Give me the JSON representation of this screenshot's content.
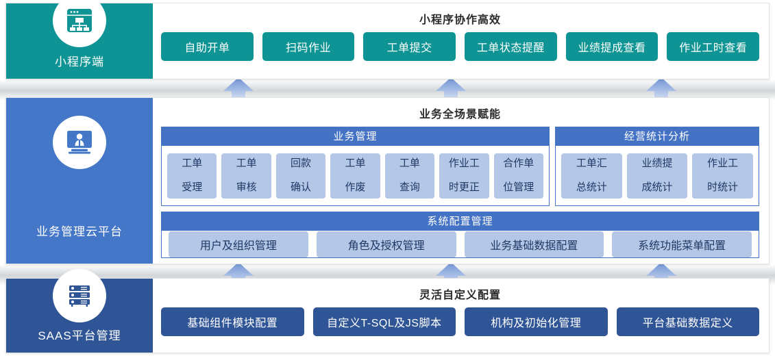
{
  "rows": [
    {
      "side_label": "小程序端",
      "side_icon": "sitemap-window-icon",
      "title": "小程序协作高效",
      "accent": "#0e9494",
      "buttons": [
        "自助开单",
        "扫码作业",
        "工单提交",
        "工单状态提醒",
        "业绩提成查看",
        "作业工时查看"
      ]
    },
    {
      "side_label": "业务管理云平台",
      "side_icon": "person-monitor-icon",
      "title": "业务全场景赋能",
      "accent": "#4472c4",
      "panels": [
        {
          "header": "业务管理",
          "chips": [
            [
              "工单",
              "受理"
            ],
            [
              "工单",
              "审核"
            ],
            [
              "回款",
              "确认"
            ],
            [
              "工单",
              "作废"
            ],
            [
              "工单",
              "查询"
            ],
            [
              "作业工",
              "时更正"
            ],
            [
              "合作单",
              "位管理"
            ]
          ]
        },
        {
          "header": "经营统计分析",
          "chips": [
            [
              "工单汇",
              "总统计"
            ],
            [
              "业绩提",
              "成统计"
            ],
            [
              "作业工",
              "时统计"
            ]
          ]
        }
      ],
      "system_panel": {
        "header": "系统配置管理",
        "chips": [
          "用户及组织管理",
          "角色及授权管理",
          "业务基础数据配置",
          "系统功能菜单配置"
        ]
      }
    },
    {
      "side_label": "SAAS平台管理",
      "side_icon": "server-rack-icon",
      "title": "灵活自定义配置",
      "accent": "#2f5597",
      "buttons": [
        "基础组件模块配置",
        "自定义T-SQL及JS脚本",
        "机构及初始化管理",
        "平台基础数据定义"
      ]
    }
  ],
  "arrows": {
    "name": "up-arrow-connector",
    "color": "#7f9fd8",
    "count_per_gap": 3
  },
  "colors": {
    "teal": "#0e9494",
    "blue": "#4577c8",
    "header_blue": "#4472c4",
    "dark_blue": "#2f5597",
    "chip_bg": "#b4c7e7",
    "chip_text": "#1f3864"
  }
}
